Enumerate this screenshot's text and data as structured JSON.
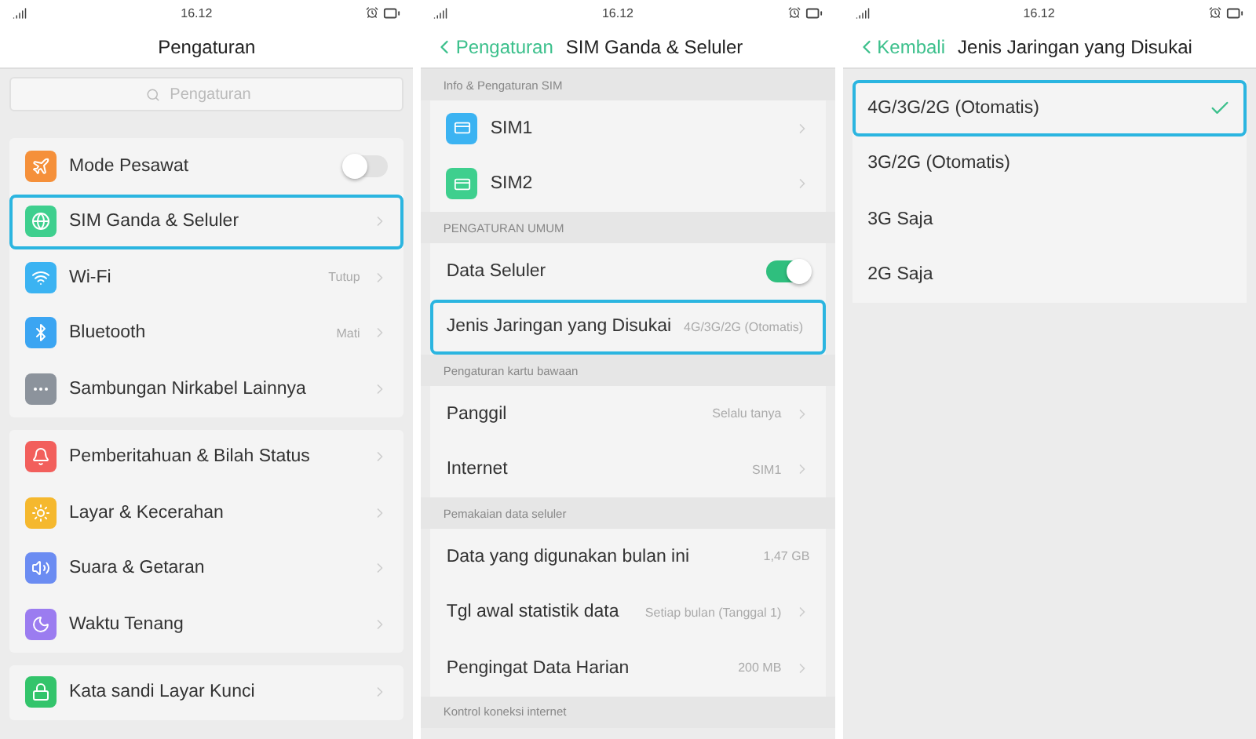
{
  "main_settings": {
    "status_bar": {
      "time": "16.12"
    },
    "title": "Pengaturan",
    "search": {
      "placeholder": "Pengaturan"
    },
    "groups": [
      {
        "items": [
          {
            "label": "Mode Pesawat",
            "color": "#f5903a",
            "kind": "toggle",
            "on": false,
            "selected": false
          },
          {
            "label": "SIM Ganda & Seluler",
            "color": "#3ecf8e",
            "kind": "link",
            "selected": true
          },
          {
            "label": "Wi-Fi",
            "color": "#3bb3f2",
            "kind": "link",
            "value": "Tutup",
            "selected": false
          },
          {
            "label": "Bluetooth",
            "color": "#3ba5f2",
            "kind": "link",
            "value": "Mati",
            "selected": false
          },
          {
            "label": "Sambungan Nirkabel Lainnya",
            "color": "#8c939c",
            "kind": "link",
            "selected": false
          }
        ]
      },
      {
        "items": [
          {
            "label": "Pemberitahuan & Bilah Status",
            "color": "#f25f5c",
            "kind": "link",
            "selected": false
          },
          {
            "label": "Layar &  Kecerahan",
            "color": "#f5b82e",
            "kind": "link",
            "selected": false
          },
          {
            "label": "Suara & Getaran",
            "color": "#6b8cf2",
            "kind": "link",
            "selected": false
          },
          {
            "label": "Waktu Tenang",
            "color": "#9b7cf0",
            "kind": "link",
            "selected": false
          }
        ]
      },
      {
        "items": [
          {
            "label": "Kata sandi Layar Kunci",
            "color": "#33c46b",
            "kind": "link",
            "selected": false
          }
        ]
      }
    ]
  },
  "sim_settings": {
    "status_bar": {
      "time": "16.12"
    },
    "back": "Pengaturan",
    "title": "SIM Ganda & Seluler",
    "sections": [
      {
        "header": "Info & Pengaturan SIM",
        "items": [
          {
            "label": "SIM1",
            "color": "#3bb3f2",
            "kind": "link",
            "selected": false
          },
          {
            "label": "SIM2",
            "color": "#3ecf8e",
            "kind": "link",
            "selected": false
          }
        ]
      },
      {
        "header": "PENGATURAN UMUM",
        "items": [
          {
            "label": "Data Seluler",
            "kind": "toggle",
            "on": true,
            "selected": false
          },
          {
            "label": "Jenis Jaringan yang Disukai",
            "kind": "link",
            "value": "4G/3G/2G (Otomatis)",
            "selected": true
          }
        ]
      },
      {
        "header": "Pengaturan kartu bawaan",
        "items": [
          {
            "label": "Panggil",
            "kind": "link",
            "value": "Selalu tanya",
            "selected": false
          },
          {
            "label": "Internet",
            "kind": "link",
            "value": "SIM1",
            "selected": false
          }
        ]
      },
      {
        "header": "Pemakaian data seluler",
        "items": [
          {
            "label": "Data yang digunakan bulan ini",
            "kind": "info",
            "value": "1,47 GB",
            "selected": false
          },
          {
            "label": "Tgl awal statistik data",
            "kind": "link",
            "value": "Setiap bulan (Tanggal 1)",
            "selected": false
          },
          {
            "label": "Pengingat Data Harian",
            "kind": "link",
            "value": "200 MB",
            "selected": false
          }
        ]
      },
      {
        "header": "Kontrol koneksi internet"
      }
    ]
  },
  "network_type": {
    "status_bar": {
      "time": "16.12"
    },
    "back": "Kembali",
    "title": "Jenis Jaringan yang Disukai",
    "options": [
      {
        "label": "4G/3G/2G (Otomatis)",
        "selected": true
      },
      {
        "label": "3G/2G (Otomatis)",
        "selected": false
      },
      {
        "label": "3G Saja",
        "selected": false
      },
      {
        "label": "2G Saja",
        "selected": false
      }
    ]
  }
}
